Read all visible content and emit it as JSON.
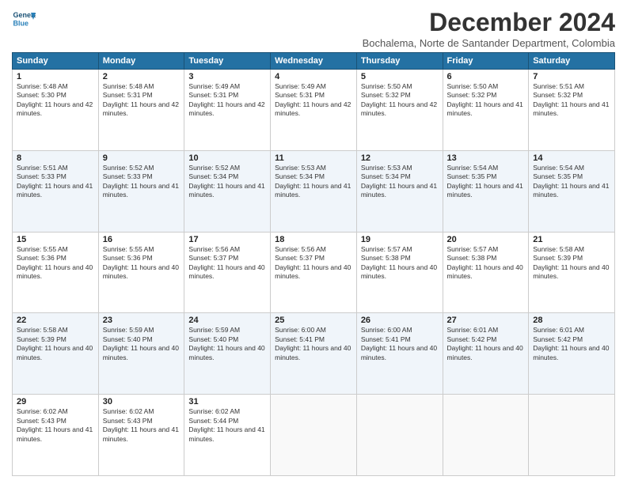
{
  "header": {
    "logo_line1": "General",
    "logo_line2": "Blue",
    "month": "December 2024",
    "location": "Bochalema, Norte de Santander Department, Colombia"
  },
  "days_of_week": [
    "Sunday",
    "Monday",
    "Tuesday",
    "Wednesday",
    "Thursday",
    "Friday",
    "Saturday"
  ],
  "weeks": [
    [
      {
        "day": "1",
        "sunrise": "5:48 AM",
        "sunset": "5:30 PM",
        "daylight": "11 hours and 42 minutes."
      },
      {
        "day": "2",
        "sunrise": "5:48 AM",
        "sunset": "5:31 PM",
        "daylight": "11 hours and 42 minutes."
      },
      {
        "day": "3",
        "sunrise": "5:49 AM",
        "sunset": "5:31 PM",
        "daylight": "11 hours and 42 minutes."
      },
      {
        "day": "4",
        "sunrise": "5:49 AM",
        "sunset": "5:31 PM",
        "daylight": "11 hours and 42 minutes."
      },
      {
        "day": "5",
        "sunrise": "5:50 AM",
        "sunset": "5:32 PM",
        "daylight": "11 hours and 42 minutes."
      },
      {
        "day": "6",
        "sunrise": "5:50 AM",
        "sunset": "5:32 PM",
        "daylight": "11 hours and 41 minutes."
      },
      {
        "day": "7",
        "sunrise": "5:51 AM",
        "sunset": "5:32 PM",
        "daylight": "11 hours and 41 minutes."
      }
    ],
    [
      {
        "day": "8",
        "sunrise": "5:51 AM",
        "sunset": "5:33 PM",
        "daylight": "11 hours and 41 minutes."
      },
      {
        "day": "9",
        "sunrise": "5:52 AM",
        "sunset": "5:33 PM",
        "daylight": "11 hours and 41 minutes."
      },
      {
        "day": "10",
        "sunrise": "5:52 AM",
        "sunset": "5:34 PM",
        "daylight": "11 hours and 41 minutes."
      },
      {
        "day": "11",
        "sunrise": "5:53 AM",
        "sunset": "5:34 PM",
        "daylight": "11 hours and 41 minutes."
      },
      {
        "day": "12",
        "sunrise": "5:53 AM",
        "sunset": "5:34 PM",
        "daylight": "11 hours and 41 minutes."
      },
      {
        "day": "13",
        "sunrise": "5:54 AM",
        "sunset": "5:35 PM",
        "daylight": "11 hours and 41 minutes."
      },
      {
        "day": "14",
        "sunrise": "5:54 AM",
        "sunset": "5:35 PM",
        "daylight": "11 hours and 41 minutes."
      }
    ],
    [
      {
        "day": "15",
        "sunrise": "5:55 AM",
        "sunset": "5:36 PM",
        "daylight": "11 hours and 40 minutes."
      },
      {
        "day": "16",
        "sunrise": "5:55 AM",
        "sunset": "5:36 PM",
        "daylight": "11 hours and 40 minutes."
      },
      {
        "day": "17",
        "sunrise": "5:56 AM",
        "sunset": "5:37 PM",
        "daylight": "11 hours and 40 minutes."
      },
      {
        "day": "18",
        "sunrise": "5:56 AM",
        "sunset": "5:37 PM",
        "daylight": "11 hours and 40 minutes."
      },
      {
        "day": "19",
        "sunrise": "5:57 AM",
        "sunset": "5:38 PM",
        "daylight": "11 hours and 40 minutes."
      },
      {
        "day": "20",
        "sunrise": "5:57 AM",
        "sunset": "5:38 PM",
        "daylight": "11 hours and 40 minutes."
      },
      {
        "day": "21",
        "sunrise": "5:58 AM",
        "sunset": "5:39 PM",
        "daylight": "11 hours and 40 minutes."
      }
    ],
    [
      {
        "day": "22",
        "sunrise": "5:58 AM",
        "sunset": "5:39 PM",
        "daylight": "11 hours and 40 minutes."
      },
      {
        "day": "23",
        "sunrise": "5:59 AM",
        "sunset": "5:40 PM",
        "daylight": "11 hours and 40 minutes."
      },
      {
        "day": "24",
        "sunrise": "5:59 AM",
        "sunset": "5:40 PM",
        "daylight": "11 hours and 40 minutes."
      },
      {
        "day": "25",
        "sunrise": "6:00 AM",
        "sunset": "5:41 PM",
        "daylight": "11 hours and 40 minutes."
      },
      {
        "day": "26",
        "sunrise": "6:00 AM",
        "sunset": "5:41 PM",
        "daylight": "11 hours and 40 minutes."
      },
      {
        "day": "27",
        "sunrise": "6:01 AM",
        "sunset": "5:42 PM",
        "daylight": "11 hours and 40 minutes."
      },
      {
        "day": "28",
        "sunrise": "6:01 AM",
        "sunset": "5:42 PM",
        "daylight": "11 hours and 40 minutes."
      }
    ],
    [
      {
        "day": "29",
        "sunrise": "6:02 AM",
        "sunset": "5:43 PM",
        "daylight": "11 hours and 41 minutes."
      },
      {
        "day": "30",
        "sunrise": "6:02 AM",
        "sunset": "5:43 PM",
        "daylight": "11 hours and 41 minutes."
      },
      {
        "day": "31",
        "sunrise": "6:02 AM",
        "sunset": "5:44 PM",
        "daylight": "11 hours and 41 minutes."
      },
      null,
      null,
      null,
      null
    ]
  ]
}
